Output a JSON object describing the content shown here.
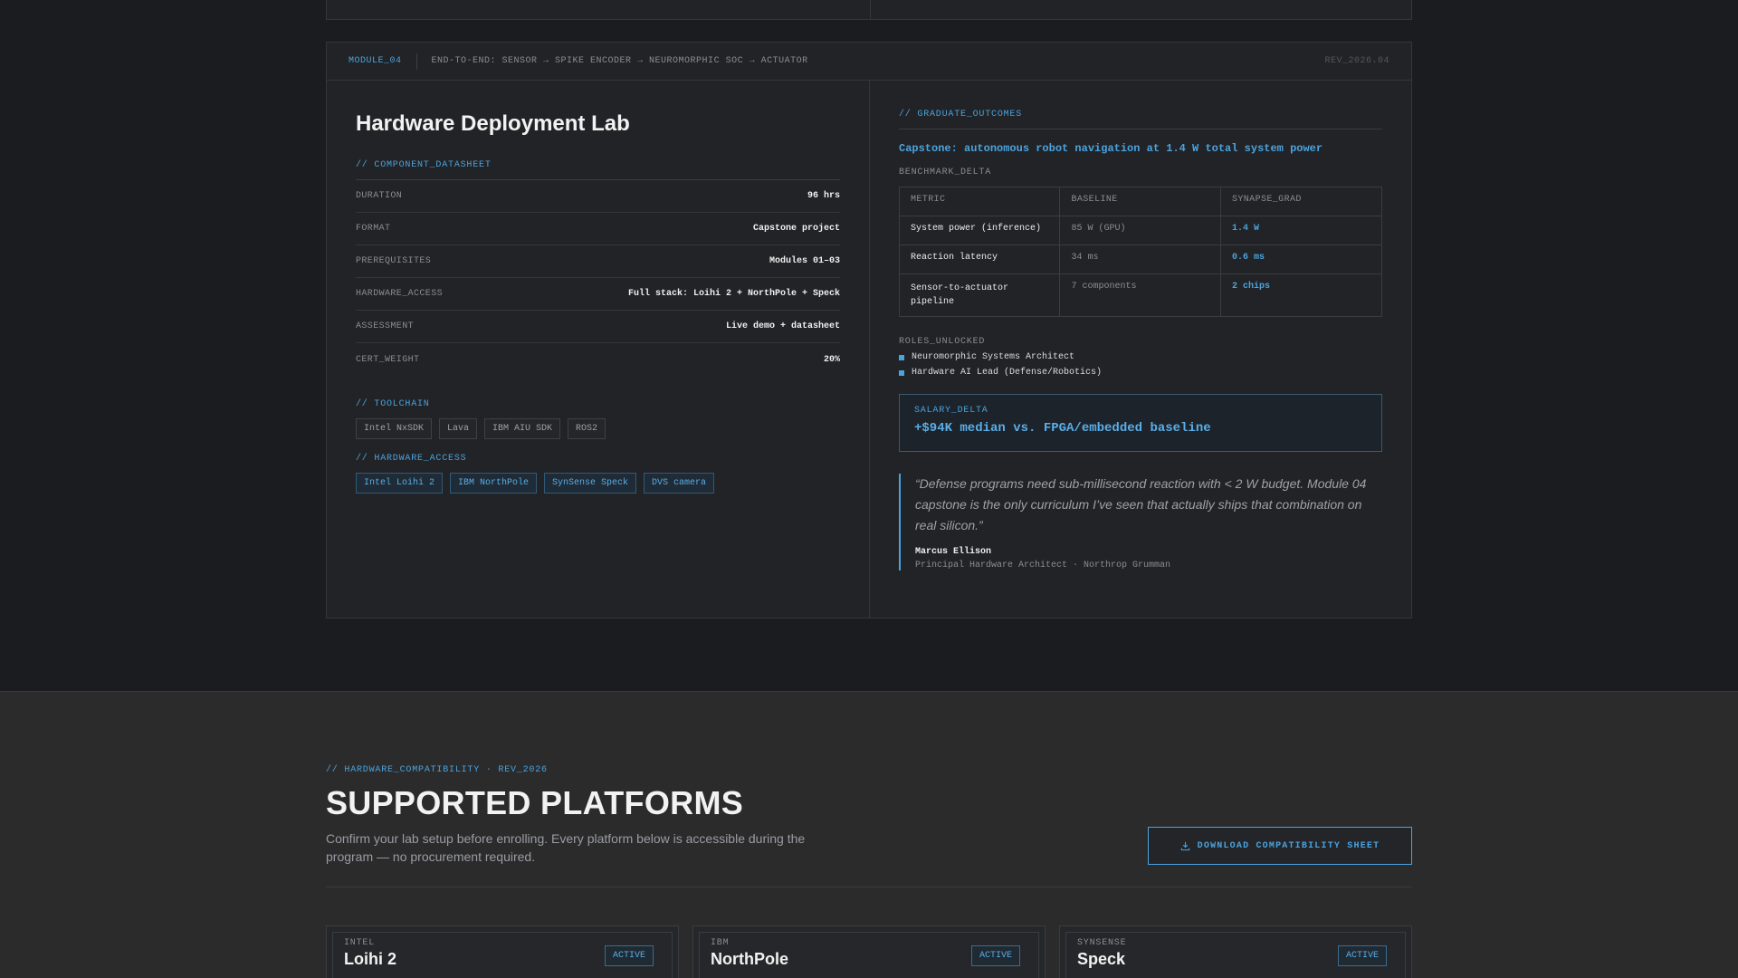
{
  "module": {
    "id": "MODULE_04",
    "path": "END-TO-END: SENSOR → SPIKE ENCODER → NEUROMORPHIC SOC → ACTUATOR",
    "rev": "REV_2026.04",
    "title": "Hardware Deployment Lab",
    "datasheet_label": "// COMPONENT_DATASHEET",
    "datasheet": [
      {
        "key": "DURATION",
        "value": "96 hrs"
      },
      {
        "key": "FORMAT",
        "value": "Capstone project"
      },
      {
        "key": "PREREQUISITES",
        "value": "Modules 01–03"
      },
      {
        "key": "HARDWARE_ACCESS",
        "value": "Full stack: Loihi 2 + NorthPole + Speck"
      },
      {
        "key": "ASSESSMENT",
        "value": "Live demo + datasheet"
      },
      {
        "key": "CERT_WEIGHT",
        "value": "20%"
      }
    ],
    "toolchain_label": "// TOOLCHAIN",
    "toolchain": [
      "Intel NxSDK",
      "Lava",
      "IBM AIU SDK",
      "ROS2"
    ],
    "hardware_label": "// HARDWARE_ACCESS",
    "hardware": [
      "Intel Loihi 2",
      "IBM NorthPole",
      "SynSense Speck",
      "DVS camera"
    ]
  },
  "outcomes": {
    "label": "// GRADUATE_OUTCOMES",
    "capstone": "Capstone: autonomous robot navigation at 1.4 W total system power",
    "benchmark_label": "BENCHMARK_DELTA",
    "table_headers": [
      "METRIC",
      "BASELINE",
      "SYNAPSE_GRAD"
    ],
    "table_rows": [
      {
        "metric": "System power (inference)",
        "baseline": "85 W (GPU)",
        "grad": "1.4 W"
      },
      {
        "metric": "Reaction latency",
        "baseline": "34 ms",
        "grad": "0.6 ms"
      },
      {
        "metric": "Sensor-to-actuator pipeline",
        "baseline": "7 components",
        "grad": "2 chips"
      }
    ],
    "roles_label": "ROLES_UNLOCKED",
    "roles": [
      "Neuromorphic Systems Architect",
      "Hardware AI Lead (Defense/Robotics)"
    ],
    "salary_label": "SALARY_DELTA",
    "salary_value": "+$94K median vs. FPGA/embedded baseline",
    "quote": "“Defense programs need sub-millisecond reaction with < 2 W budget. Module 04 capstone is the only curriculum I’ve seen that actually ships that combination on real silicon.”",
    "quote_author": "Marcus Ellison",
    "quote_role": "Principal Hardware Architect · Northrop Grumman"
  },
  "platforms": {
    "kicker": "// HARDWARE_COMPATIBILITY · REV_2026",
    "title": "SUPPORTED PLATFORMS",
    "description": "Confirm your lab setup before enrolling. Every platform below is accessible during the program — no procurement required.",
    "download_label": "DOWNLOAD COMPATIBILITY SHEET",
    "cards": [
      {
        "vendor": "INTEL",
        "name": "Loihi 2",
        "status": "ACTIVE"
      },
      {
        "vendor": "IBM",
        "name": "NorthPole",
        "status": "ACTIVE"
      },
      {
        "vendor": "SYNSENSE",
        "name": "Speck",
        "status": "ACTIVE"
      }
    ]
  },
  "icons": {
    "download": "download-icon"
  },
  "colors": {
    "accent": "#4aa3df",
    "background": "#1b1c1f",
    "panel": "#222326"
  }
}
